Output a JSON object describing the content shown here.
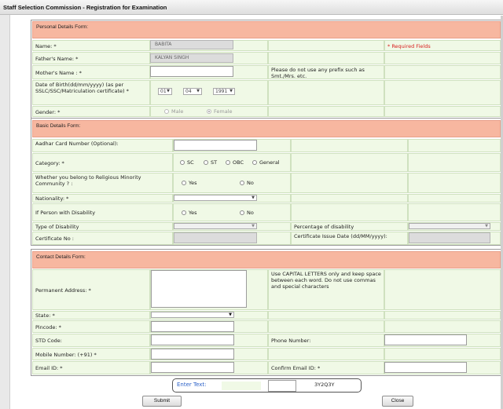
{
  "window": {
    "title": "Staff Selection Commission - Registration for Examination"
  },
  "personal": {
    "header": "Personal Details Form:",
    "required_note": "* Required Fields",
    "name_label": "Name: *",
    "name_value": "BABITA",
    "father_label": "Father's Name: *",
    "father_value": "KALYAN SINGH",
    "mother_label": "Mother's Name : *",
    "mother_value": "",
    "prefix_note": "Please do not use any prefix such as Smt./Mrs. etc.",
    "dob_label": "Date of Birth(dd/mm/yyyy) (as per SSLC/SSC/Matriculation certificate) *",
    "dob_day": "01",
    "dob_month": "04",
    "dob_year": "1991",
    "gender_label": "Gender: *",
    "gender_options": [
      "Male",
      "Female"
    ],
    "gender_selected": "Female"
  },
  "basic": {
    "header": "Basic Details Form:",
    "aadhar_label": "Aadhar Card Number (Optional):",
    "category_label": "Category: *",
    "category_options": [
      "SC",
      "ST",
      "OBC",
      "General"
    ],
    "minority_label": "Whether you belong to Religious Minority Community ? :",
    "yes": "Yes",
    "no": "No",
    "nationality_label": "Nationality: *",
    "disability_label": "If Person with Disability",
    "type_label": "Type of Disability",
    "percentage_label": "Percentage of disability",
    "cert_no_label": "Certificate No :",
    "cert_date_label": "Certificate Issue Date (dd/MM/yyyy):"
  },
  "contact": {
    "header": "Contact Details Form:",
    "address_label": "Permanent Address: *",
    "address_note": "Use CAPITAL LETTERS only and keep space between each word. Do not use commas and special characters",
    "state_label": "State: *",
    "pincode_label": "Pincode: *",
    "std_label": "STD Code:",
    "phone_label": "Phone Number:",
    "mobile_label": "Mobile Number: (+91) *",
    "email_label": "Email ID: *",
    "confirm_email_label": "Confirm Email ID: *"
  },
  "captcha": {
    "label": "Enter Text:",
    "code": "3Y2Q3Y"
  },
  "buttons": {
    "submit": "Submit",
    "close": "Close"
  }
}
